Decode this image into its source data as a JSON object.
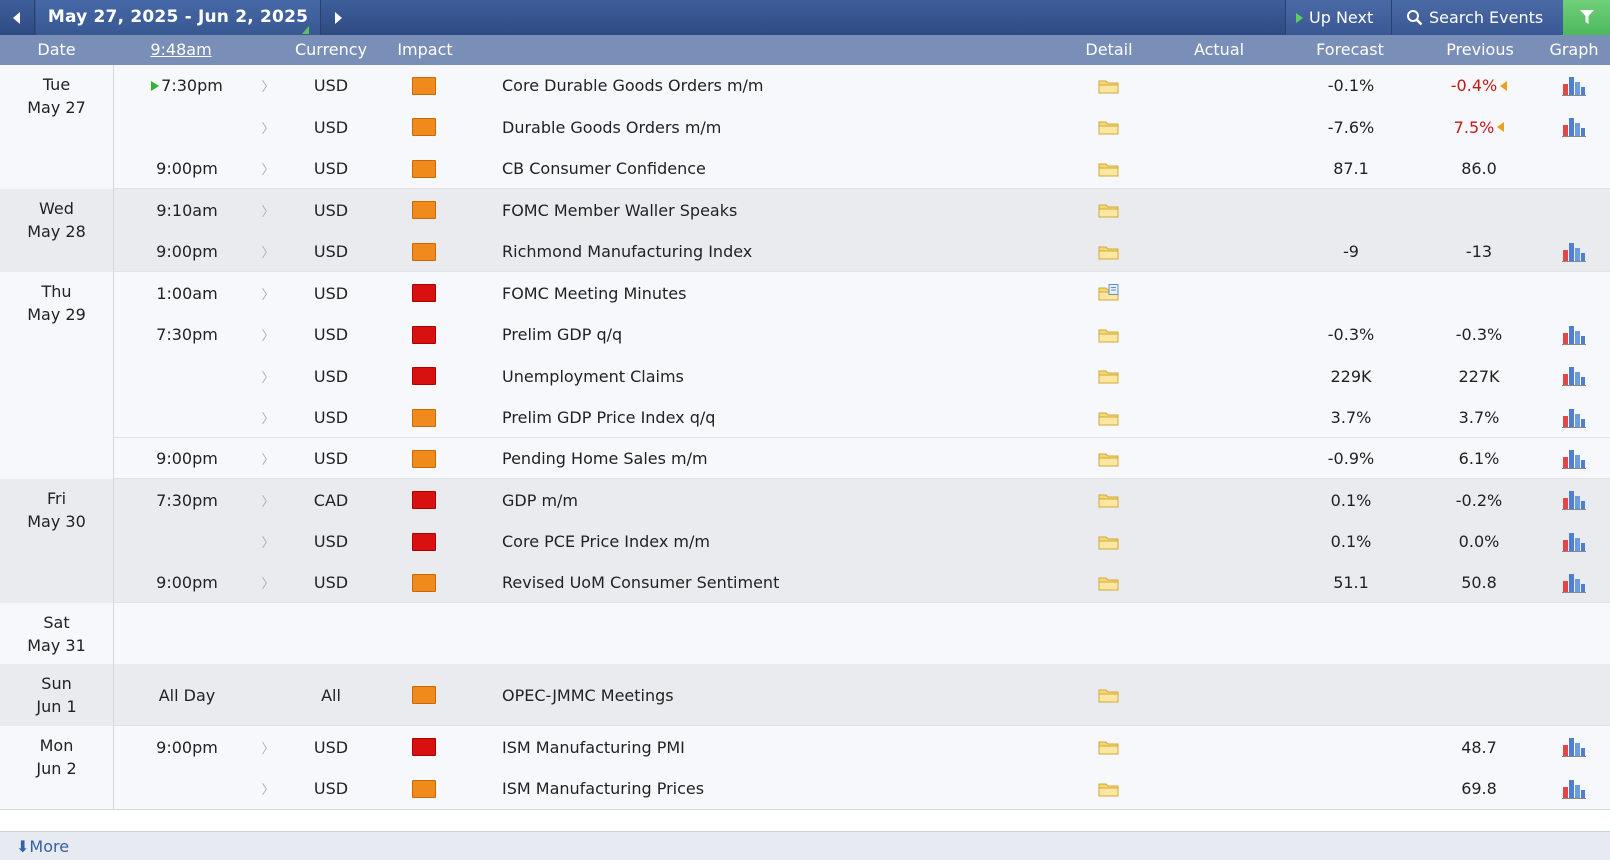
{
  "nav": {
    "prev_icon": "left-triangle",
    "range_label": "May 27, 2025 - Jun 2, 2025",
    "next_icon": "right-triangle",
    "up_next_label": "Up Next",
    "search_label": "Search Events",
    "filter_icon": "filter-funnel",
    "accent_color": "#4db85c"
  },
  "header": {
    "date": "Date",
    "time": "9:48am",
    "currency": "Currency",
    "impact": "Impact",
    "detail": "Detail",
    "actual": "Actual",
    "forecast": "Forecast",
    "previous": "Previous",
    "graph": "Graph"
  },
  "colors": {
    "high_impact": "#d81010",
    "medium_impact": "#f08a1c",
    "revised_down": "#c51818"
  },
  "days": [
    {
      "weekday": "Tue",
      "date": "May 27"
    },
    {
      "weekday": "Wed",
      "date": "May 28"
    },
    {
      "weekday": "Thu",
      "date": "May 29"
    },
    {
      "weekday": "Fri",
      "date": "May 30"
    },
    {
      "weekday": "Sat",
      "date": "May 31"
    },
    {
      "weekday": "Sun",
      "date": "Jun 1"
    },
    {
      "weekday": "Mon",
      "date": "Jun 2"
    }
  ],
  "events": [
    {
      "time": "7:30pm",
      "up_next": true,
      "currency": "USD",
      "impact": "medium",
      "title": "Core Durable Goods Orders m/m",
      "detail": "folder",
      "actual": "",
      "forecast": "-0.1%",
      "previous": "-0.4%",
      "revised": true,
      "graph": true
    },
    {
      "time": "",
      "currency": "USD",
      "impact": "medium",
      "title": "Durable Goods Orders m/m",
      "detail": "folder",
      "actual": "",
      "forecast": "-7.6%",
      "previous": "7.5%",
      "revised": true,
      "graph": true
    },
    {
      "time": "9:00pm",
      "currency": "USD",
      "impact": "medium",
      "title": "CB Consumer Confidence",
      "detail": "folder",
      "actual": "",
      "forecast": "87.1",
      "previous": "86.0",
      "revised": false,
      "graph": false
    },
    {
      "time": "9:10am",
      "currency": "USD",
      "impact": "medium",
      "title": "FOMC Member Waller Speaks",
      "detail": "folder",
      "actual": "",
      "forecast": "",
      "previous": "",
      "revised": false,
      "graph": false
    },
    {
      "time": "9:00pm",
      "currency": "USD",
      "impact": "medium",
      "title": "Richmond Manufacturing Index",
      "detail": "folder",
      "actual": "",
      "forecast": "-9",
      "previous": "-13",
      "revised": false,
      "graph": true
    },
    {
      "time": "1:00am",
      "currency": "USD",
      "impact": "high",
      "title": "FOMC Meeting Minutes",
      "detail": "folder-doc",
      "actual": "",
      "forecast": "",
      "previous": "",
      "revised": false,
      "graph": false
    },
    {
      "time": "7:30pm",
      "currency": "USD",
      "impact": "high",
      "title": "Prelim GDP q/q",
      "detail": "folder",
      "actual": "",
      "forecast": "-0.3%",
      "previous": "-0.3%",
      "revised": false,
      "graph": true
    },
    {
      "time": "",
      "currency": "USD",
      "impact": "high",
      "title": "Unemployment Claims",
      "detail": "folder",
      "actual": "",
      "forecast": "229K",
      "previous": "227K",
      "revised": false,
      "graph": true
    },
    {
      "time": "",
      "currency": "USD",
      "impact": "medium",
      "title": "Prelim GDP Price Index q/q",
      "detail": "folder",
      "actual": "",
      "forecast": "3.7%",
      "previous": "3.7%",
      "revised": false,
      "graph": true
    },
    {
      "time": "9:00pm",
      "currency": "USD",
      "impact": "medium",
      "title": "Pending Home Sales m/m",
      "detail": "folder",
      "actual": "",
      "forecast": "-0.9%",
      "previous": "6.1%",
      "revised": false,
      "graph": true
    },
    {
      "time": "7:30pm",
      "currency": "CAD",
      "impact": "high",
      "title": "GDP m/m",
      "detail": "folder",
      "actual": "",
      "forecast": "0.1%",
      "previous": "-0.2%",
      "revised": false,
      "graph": true
    },
    {
      "time": "",
      "currency": "USD",
      "impact": "high",
      "title": "Core PCE Price Index m/m",
      "detail": "folder",
      "actual": "",
      "forecast": "0.1%",
      "previous": "0.0%",
      "revised": false,
      "graph": true
    },
    {
      "time": "9:00pm",
      "currency": "USD",
      "impact": "medium",
      "title": "Revised UoM Consumer Sentiment",
      "detail": "folder",
      "actual": "",
      "forecast": "51.1",
      "previous": "50.8",
      "revised": false,
      "graph": true
    },
    {
      "time": "All Day",
      "currency": "All",
      "impact": "medium",
      "title": "OPEC-JMMC Meetings",
      "detail": "folder",
      "actual": "",
      "forecast": "",
      "previous": "",
      "revised": false,
      "graph": false
    },
    {
      "time": "9:00pm",
      "currency": "USD",
      "impact": "high",
      "title": "ISM Manufacturing PMI",
      "detail": "folder",
      "actual": "",
      "forecast": "",
      "previous": "48.7",
      "revised": false,
      "graph": true
    },
    {
      "time": "",
      "currency": "USD",
      "impact": "medium",
      "title": "ISM Manufacturing Prices",
      "detail": "folder",
      "actual": "",
      "forecast": "",
      "previous": "69.8",
      "revised": false,
      "graph": true
    }
  ],
  "footer": {
    "more_label": "More",
    "more_icon": "download-arrow"
  }
}
